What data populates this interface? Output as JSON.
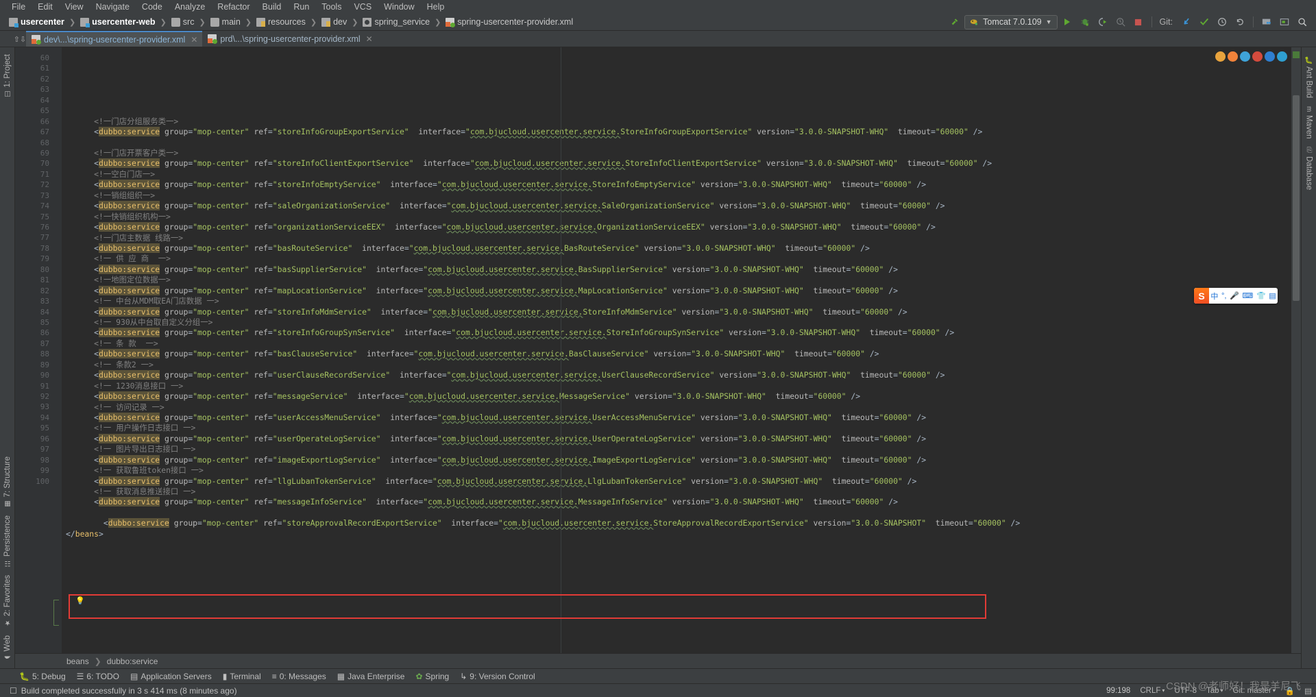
{
  "menu": {
    "items": [
      "File",
      "Edit",
      "View",
      "Navigate",
      "Code",
      "Analyze",
      "Refactor",
      "Build",
      "Run",
      "Tools",
      "VCS",
      "Window",
      "Help"
    ]
  },
  "navbar": {
    "breadcrumbs": [
      {
        "label": "usercenter",
        "icon": "module-icon",
        "bold": true
      },
      {
        "label": "usercenter-web",
        "icon": "module-icon",
        "bold": true
      },
      {
        "label": "src",
        "icon": "folder-icon",
        "bold": false
      },
      {
        "label": "main",
        "icon": "folder-icon",
        "bold": false
      },
      {
        "label": "resources",
        "icon": "resources-folder-icon",
        "bold": false
      },
      {
        "label": "dev",
        "icon": "resources-folder-icon",
        "bold": false
      },
      {
        "label": "spring_service",
        "icon": "spring-folder-icon",
        "bold": false
      },
      {
        "label": "spring-usercenter-provider.xml",
        "icon": "xml-file-icon",
        "bold": false
      }
    ],
    "run_config": "Tomcat 7.0.109",
    "git_label": "Git:",
    "buttons": [
      "run-button",
      "debug-button",
      "run-coverage-button",
      "profile-button",
      "stop-button"
    ],
    "git_buttons": [
      "update-project-button",
      "commit-button",
      "history-button",
      "rollback-button"
    ],
    "right_buttons": [
      "project-structure-button",
      "console-button",
      "search-everywhere-button"
    ]
  },
  "tabs": [
    {
      "label": "dev\\...\\spring-usercenter-provider.xml",
      "active": true
    },
    {
      "label": "prd\\...\\spring-usercenter-provider.xml",
      "active": false
    }
  ],
  "left_strip": [
    {
      "label": "1: Project",
      "icon": "project-icon"
    },
    {
      "label": "7: Structure",
      "icon": "structure-icon"
    },
    {
      "label": "Persistence",
      "icon": "persistence-icon"
    },
    {
      "label": "2: Favorites",
      "icon": "star-icon"
    },
    {
      "label": "Web",
      "icon": "web-icon"
    }
  ],
  "right_strip": [
    {
      "label": "Ant Build",
      "icon": "ant-icon"
    },
    {
      "label": "Maven",
      "icon": "maven-icon"
    },
    {
      "label": "Database",
      "icon": "database-icon"
    }
  ],
  "breadcrumb_bottom": [
    "beans",
    "dubbo:service"
  ],
  "toolwindows": [
    {
      "label": "5: Debug",
      "accel": "5",
      "icon": "debug-icon"
    },
    {
      "label": "6: TODO",
      "accel": "6",
      "icon": "todo-icon"
    },
    {
      "label": "Application Servers",
      "accel": "",
      "icon": "server-icon"
    },
    {
      "label": "Terminal",
      "accel": "",
      "icon": "terminal-icon"
    },
    {
      "label": "0: Messages",
      "accel": "0",
      "icon": "messages-icon"
    },
    {
      "label": "Java Enterprise",
      "accel": "",
      "icon": "java-ee-icon"
    },
    {
      "label": "Spring",
      "accel": "",
      "icon": "spring-leaf-icon"
    },
    {
      "label": "9: Version Control",
      "accel": "9",
      "icon": "vcs-icon"
    }
  ],
  "status": {
    "message": "Build completed successfully in 3 s 414 ms (8 minutes ago)",
    "caret": "99:198",
    "line_sep": "CRLF",
    "encoding": "UTF-8",
    "indent": "Tab",
    "branch": "Git: master"
  },
  "ime": {
    "logo": "S",
    "buttons": [
      "中",
      "°,",
      "mic-icon",
      "keyboard-icon",
      "skin-icon",
      "apps-icon"
    ]
  },
  "watermark": "CSDN @老师好！我是羊尼飞",
  "editor": {
    "first_line": 60,
    "lines": [
      {
        "n": 60,
        "type": "blank",
        "text": ""
      },
      {
        "n": 61,
        "type": "comment",
        "text": "<!一门店分组服务类一>"
      },
      {
        "n": 62,
        "type": "service",
        "ref": "storeInfoGroupExportService",
        "iface": "StoreInfoGroupExportService",
        "version": "3.0.0-SNAPSHOT-WHQ",
        "timeout": "60000"
      },
      {
        "n": 63,
        "type": "blank",
        "text": ""
      },
      {
        "n": 64,
        "type": "comment",
        "text": "<!一门店开票客户类一>"
      },
      {
        "n": 65,
        "type": "service",
        "ref": "storeInfoClientExportService",
        "iface": "StoreInfoClientExportService",
        "version": "3.0.0-SNAPSHOT-WHQ",
        "timeout": "60000"
      },
      {
        "n": 66,
        "type": "comment",
        "text": "<!一空白门店一>"
      },
      {
        "n": 67,
        "type": "service",
        "ref": "storeInfoEmptyService",
        "iface": "StoreInfoEmptyService",
        "version": "3.0.0-SNAPSHOT-WHQ",
        "timeout": "60000"
      },
      {
        "n": 68,
        "type": "comment",
        "text": "<!一销组组织一>"
      },
      {
        "n": 69,
        "type": "service",
        "ref": "saleOrganizationService",
        "iface": "SaleOrganizationService",
        "version": "3.0.0-SNAPSHOT-WHQ",
        "timeout": "60000"
      },
      {
        "n": 70,
        "type": "comment",
        "text": "<!一快销组织机构一>"
      },
      {
        "n": 71,
        "type": "service",
        "ref": "organizationServiceEEX",
        "iface": "OrganizationServiceEEX",
        "version": "3.0.0-SNAPSHOT-WHQ",
        "timeout": "60000"
      },
      {
        "n": 72,
        "type": "comment",
        "text": "<!一门店主数据 线路一>"
      },
      {
        "n": 73,
        "type": "service",
        "ref": "basRouteService",
        "iface": "BasRouteService",
        "version": "3.0.0-SNAPSHOT-WHQ",
        "timeout": "60000"
      },
      {
        "n": 74,
        "type": "comment",
        "text": "<!一 供 应 商  一>"
      },
      {
        "n": 75,
        "type": "service",
        "ref": "basSupplierService",
        "iface": "BasSupplierService",
        "version": "3.0.0-SNAPSHOT-WHQ",
        "timeout": "60000"
      },
      {
        "n": 76,
        "type": "comment",
        "text": "<!一地图定位数据一>"
      },
      {
        "n": 77,
        "type": "service",
        "ref": "mapLocationService",
        "iface": "MapLocationService",
        "version": "3.0.0-SNAPSHOT-WHQ",
        "timeout": "60000"
      },
      {
        "n": 78,
        "type": "comment",
        "text": "<!一 中台从MDM取EA门店数据 一>"
      },
      {
        "n": 79,
        "type": "service",
        "ref": "storeInfoMdmService",
        "iface": "StoreInfoMdmService",
        "version": "3.0.0-SNAPSHOT-WHQ",
        "timeout": "60000"
      },
      {
        "n": 80,
        "type": "comment",
        "text": "<!一 930从中台取自定义分组一>"
      },
      {
        "n": 81,
        "type": "service",
        "ref": "storeInfoGroupSynService",
        "iface": "StoreInfoGroupSynService",
        "version": "3.0.0-SNAPSHOT-WHQ",
        "timeout": "60000"
      },
      {
        "n": 82,
        "type": "comment",
        "text": "<!一 条 款  一>"
      },
      {
        "n": 83,
        "type": "service",
        "ref": "basClauseService",
        "iface": "BasClauseService",
        "version": "3.0.0-SNAPSHOT-WHQ",
        "timeout": "60000"
      },
      {
        "n": 84,
        "type": "comment",
        "text": "<!一 条款2 一>"
      },
      {
        "n": 85,
        "type": "service",
        "ref": "userClauseRecordService",
        "iface": "UserClauseRecordService",
        "version": "3.0.0-SNAPSHOT-WHQ",
        "timeout": "60000"
      },
      {
        "n": 86,
        "type": "comment",
        "text": "<!一 1230消息接口 一>"
      },
      {
        "n": 87,
        "type": "service",
        "ref": "messageService",
        "iface": "MessageService",
        "version": "3.0.0-SNAPSHOT-WHQ",
        "timeout": "60000"
      },
      {
        "n": 88,
        "type": "comment",
        "text": "<!一 访问记录 一>"
      },
      {
        "n": 89,
        "type": "service",
        "ref": "userAccessMenuService",
        "iface": "UserAccessMenuService",
        "version": "3.0.0-SNAPSHOT-WHQ",
        "timeout": "60000"
      },
      {
        "n": 90,
        "type": "comment",
        "text": "<!一 用户操作日志接口 一>"
      },
      {
        "n": 91,
        "type": "service",
        "ref": "userOperateLogService",
        "iface": "UserOperateLogService",
        "version": "3.0.0-SNAPSHOT-WHQ",
        "timeout": "60000"
      },
      {
        "n": 92,
        "type": "comment",
        "text": "<!一 图片导出日志接口 一>"
      },
      {
        "n": 93,
        "type": "service",
        "ref": "imageExportLogService",
        "iface": "ImageExportLogService",
        "version": "3.0.0-SNAPSHOT-WHQ",
        "timeout": "60000"
      },
      {
        "n": 94,
        "type": "comment",
        "text": "<!一 获取鲁班token接口 一>"
      },
      {
        "n": 95,
        "type": "service",
        "ref": "llgLubanTokenService",
        "iface": "LlgLubanTokenService",
        "version": "3.0.0-SNAPSHOT-WHQ",
        "timeout": "60000"
      },
      {
        "n": 96,
        "type": "comment",
        "text": "<!一 获取消息推送接口 一>"
      },
      {
        "n": 97,
        "type": "service",
        "ref": "messageInfoService",
        "iface": "MessageInfoService",
        "version": "3.0.0-SNAPSHOT-WHQ",
        "timeout": "60000"
      },
      {
        "n": 98,
        "type": "blank",
        "text": ""
      },
      {
        "n": 99,
        "type": "service-highlight",
        "ref": "storeApprovalRecordExportService",
        "iface": "StoreApprovalRecordExportService",
        "version": "3.0.0-SNAPSHOT",
        "timeout": "60000"
      },
      {
        "n": 100,
        "type": "close",
        "text": "</beans>"
      }
    ],
    "tag_name": "dubbo:service",
    "attr_group": "group",
    "group_value": "mop-center",
    "attr_ref": "ref",
    "attr_interface": "interface",
    "iface_prefix": "com.bjucloud.usercenter.service.",
    "attr_version": "version",
    "attr_timeout": "timeout",
    "self_close": "/>"
  },
  "colors": {
    "background": "#2b2b2b",
    "chrome": "#3c3f41",
    "accent": "#4a88c7",
    "error": "#e23b36",
    "string": "#a5c261",
    "tag": "#e8bf6a",
    "comment": "#808080",
    "highlight": "#5b5339"
  }
}
